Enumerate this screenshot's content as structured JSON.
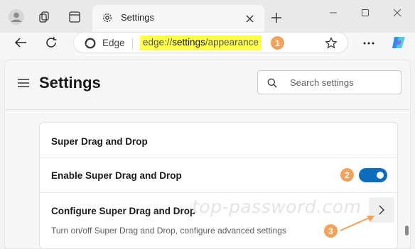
{
  "tab": {
    "title": "Settings"
  },
  "address_bar": {
    "site_label": "Edge",
    "url_scheme": "edge://",
    "url_section": "settings",
    "url_slash": "/",
    "url_page": "appearance",
    "highlight_color": "#ffff4a"
  },
  "header": {
    "title": "Settings",
    "search_placeholder": "Search settings"
  },
  "card": {
    "section_title": "Super Drag and Drop",
    "toggle_row": {
      "label": "Enable Super Drag and Drop",
      "enabled": true
    },
    "configure_row": {
      "label": "Configure Super Drag and Drop",
      "description": "Turn on/off Super Drag and Drop, configure advanced settings"
    }
  },
  "annotations": {
    "badge_1": "1",
    "badge_2": "2",
    "badge_3": "3",
    "badge_color": "#f2a25a"
  },
  "watermark": "top-password.com",
  "colors": {
    "accent": "#0f6cbd",
    "copilot": "#2d8cf0"
  }
}
